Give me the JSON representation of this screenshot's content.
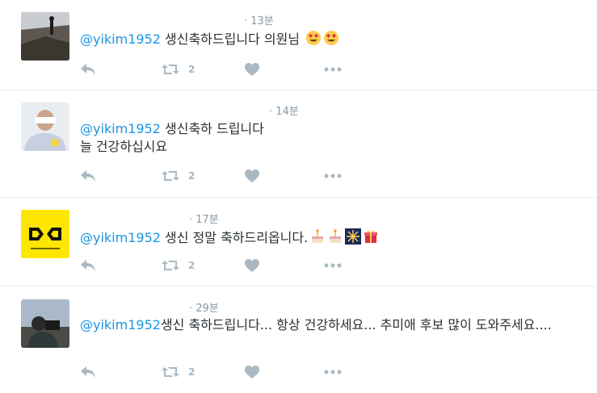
{
  "tweets": [
    {
      "time": "· 13분",
      "mention": "@yikim1952",
      "text": " 생신축하드립니다 의원님",
      "emojis": [
        "heart-eyes-icon",
        "heart-eyes-icon"
      ],
      "retweet_count": "2"
    },
    {
      "time": "· 14분",
      "mention": "@yikim1952",
      "text": " 생신축하 드립니다\n늘 건강하십시요",
      "emojis": [],
      "retweet_count": "2"
    },
    {
      "time": "· 17분",
      "mention": "@yikim1952",
      "text": " 생신 정말 축하드리옵니다.",
      "emojis": [
        "cake-icon",
        "cake-icon",
        "fireworks-icon",
        "gift-icon"
      ],
      "retweet_count": "2"
    },
    {
      "time": "· 29분",
      "mention": "@yikim1952",
      "text": "생신 축하드립니다... 항상 건강하세요... 추미애 후보 많이 도와주세요....",
      "emojis": [],
      "retweet_count": "2"
    }
  ],
  "icons": {
    "reply": "reply-icon",
    "retweet": "retweet-icon",
    "like": "heart-icon",
    "more": "more-icon"
  },
  "colors": {
    "mention": "#1b95e0",
    "action": "#aab8c2",
    "time": "#8899a6",
    "divider": "#e6ecf0",
    "avatar3_bg": "#ffe600"
  }
}
